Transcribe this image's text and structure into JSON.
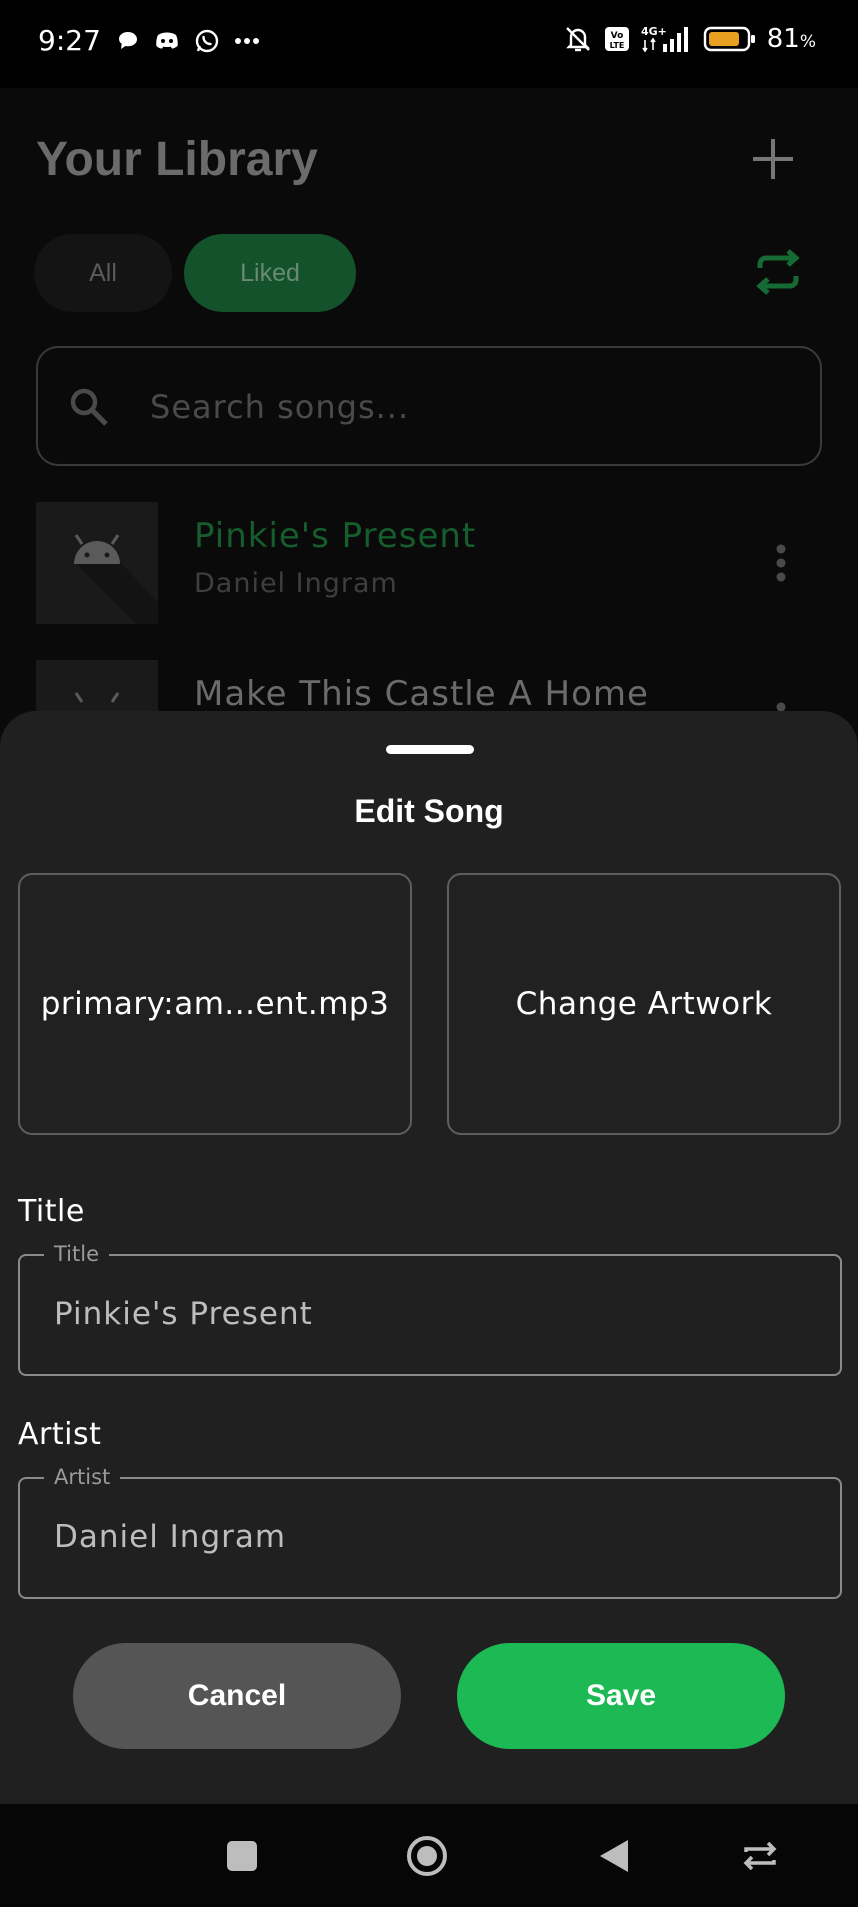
{
  "status_bar": {
    "time": "9:27",
    "battery": "81",
    "battery_unit": "%",
    "left_icons": [
      "chat-bubble-icon",
      "discord-icon",
      "whatsapp-icon",
      "more-dots-icon"
    ],
    "right_icons": [
      "bell-muted-icon",
      "volte-icon",
      "signal-4g-icon",
      "battery-icon"
    ]
  },
  "library": {
    "title": "Your Library",
    "filters": [
      {
        "label": "All",
        "selected": false
      },
      {
        "label": "Liked",
        "selected": true
      }
    ],
    "search": {
      "placeholder": "Search songs..."
    },
    "songs": [
      {
        "title": "Pinkie's Present",
        "artist": "Daniel Ingram",
        "playing": true
      },
      {
        "title": "Make This Castle A Home",
        "artist": ""
      }
    ]
  },
  "sheet": {
    "title": "Edit Song",
    "file_tile": "primary:am...ent.mp3",
    "artwork_tile": "Change Artwork",
    "fields": [
      {
        "label": "Title",
        "legend": "Title",
        "value": "Pinkie's Present"
      },
      {
        "label": "Artist",
        "legend": "Artist",
        "value": "Daniel Ingram"
      }
    ],
    "cancel_label": "Cancel",
    "save_label": "Save"
  },
  "colors": {
    "accent": "#1db954",
    "sheet_background": "#202020",
    "cancel_button": "#555555"
  },
  "nav_bar": {
    "icons": [
      "recents-square-icon",
      "home-circle-icon",
      "back-triangle-icon",
      "switch-app-icon"
    ]
  }
}
